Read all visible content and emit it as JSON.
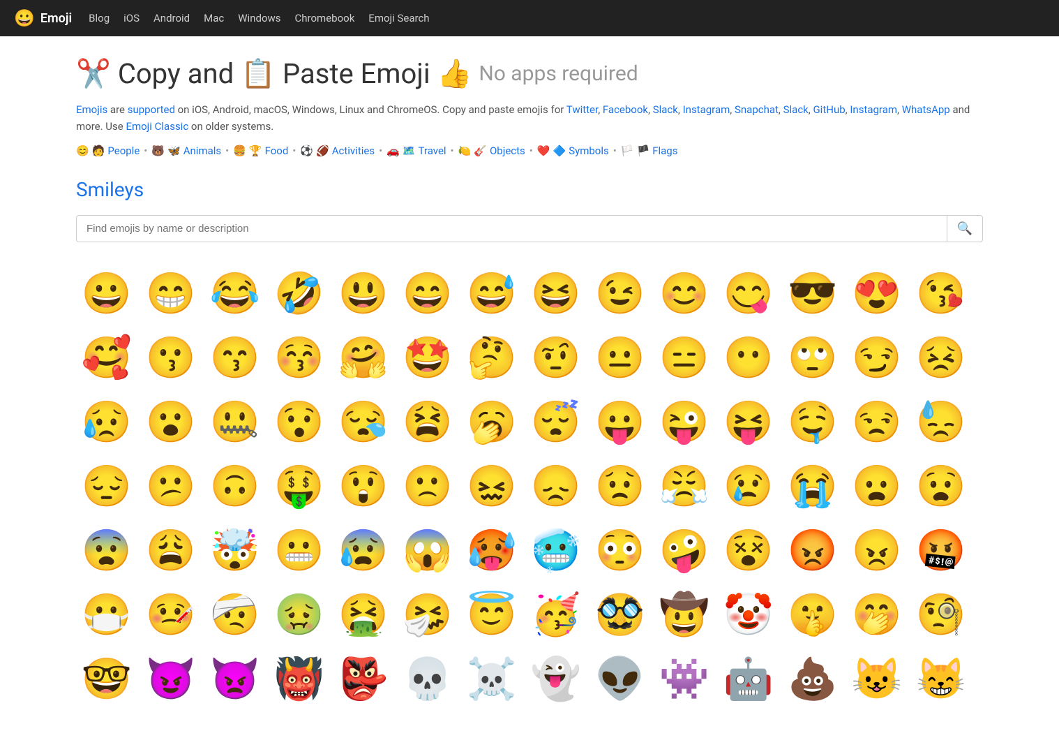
{
  "nav": {
    "logo_icon": "😀",
    "logo_text": "Emoji",
    "links": [
      "Blog",
      "iOS",
      "Android",
      "Mac",
      "Windows",
      "Chromebook",
      "Emoji Search"
    ]
  },
  "header": {
    "scissors_icon": "✂️",
    "copy_text": "Copy and",
    "clipboard_icon": "📋",
    "paste_emoji_text": "Paste Emoji",
    "thumbs_icon": "👍",
    "no_apps_text": "No apps required"
  },
  "description": {
    "text1": "Emojis",
    "text2": " are ",
    "text3": "supported",
    "text4": " on iOS, Android, macOS, Windows, Linux and ChromeOS. Copy and paste emojis for ",
    "links": [
      "Twitter",
      "Facebook",
      "Slack",
      "Instagram",
      "Snapchat",
      "Slack",
      "GitHub",
      "Instagram",
      "WhatsApp"
    ],
    "text5": " and more. Use ",
    "classic_link": "Emoji Classic",
    "text6": " on older systems."
  },
  "categories": [
    {
      "icon": "😊",
      "icon2": "🧑",
      "label": "People"
    },
    {
      "icon": "🐻",
      "icon2": "🦋",
      "label": "Animals"
    },
    {
      "icon": "🍔",
      "icon2": "🏆",
      "label": "Food"
    },
    {
      "icon": "⚽",
      "icon2": "🏈",
      "label": "Activities"
    },
    {
      "icon": "🚗",
      "icon2": "🗺️",
      "label": "Travel"
    },
    {
      "icon": "🍋",
      "icon2": "🎸",
      "label": "Objects"
    },
    {
      "icon": "❤️",
      "icon2": "🔷",
      "label": "Symbols"
    },
    {
      "icon": "🏳️",
      "icon2": "🏴",
      "label": "Flags"
    }
  ],
  "section_title": "Smileys",
  "search": {
    "placeholder": "Find emojis by name or description"
  },
  "emojis": [
    "😀",
    "😁",
    "😂",
    "🤣",
    "😃",
    "😄",
    "😅",
    "😆",
    "😉",
    "😊",
    "😋",
    "😎",
    "😍",
    "😘",
    "🥰",
    "😗",
    "😙",
    "😚",
    "🤗",
    "🤩",
    "🤔",
    "🤨",
    "😐",
    "😑",
    "😶",
    "🙄",
    "😏",
    "😣",
    "😥",
    "😮",
    "🤐",
    "😯",
    "😪",
    "😫",
    "🥱",
    "😴",
    "😛",
    "😜",
    "😝",
    "🤤",
    "😒",
    "😓",
    "😔",
    "😕",
    "🙃",
    "🤑",
    "😲",
    "🙁",
    "😖",
    "😞",
    "😟",
    "😤",
    "😢",
    "😭",
    "😦",
    "😧",
    "😨",
    "😩",
    "🤯",
    "😬",
    "😰",
    "😱",
    "🥵",
    "🥶",
    "😳",
    "🤪",
    "😵",
    "😡",
    "😠",
    "🤬",
    "😷",
    "🤒",
    "🤕",
    "🤢",
    "🤮",
    "🤧",
    "😇",
    "🥳",
    "🥸",
    "🤠",
    "🤡",
    "🤫",
    "🤭",
    "🧐",
    "🤓",
    "😈",
    "👿",
    "👹",
    "👺",
    "💀",
    "☠️",
    "👻",
    "👽",
    "👾",
    "🤖",
    "💩",
    "😺",
    "😸"
  ]
}
